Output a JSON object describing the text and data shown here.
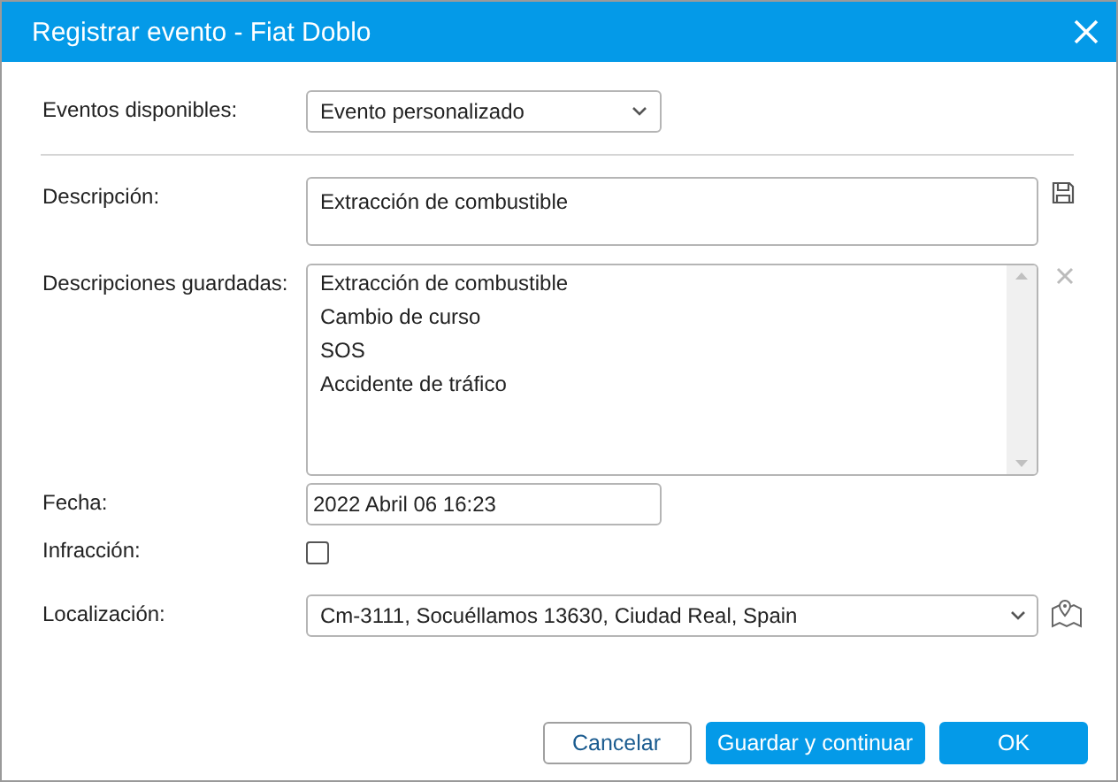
{
  "window": {
    "title": "Registrar evento - Fiat Doblo"
  },
  "available_events": {
    "label": "Eventos disponibles:",
    "value": "Evento personalizado"
  },
  "description": {
    "label": "Descripción:",
    "value": "Extracción de combustible"
  },
  "saved_descriptions": {
    "label": "Descripciones guardadas:",
    "items": [
      "Extracción de combustible",
      "Cambio de curso",
      "SOS",
      "Accidente de tráfico"
    ]
  },
  "date": {
    "label": "Fecha:",
    "value": "2022 Abril 06 16:23"
  },
  "violation": {
    "label": "Infracción:",
    "checked": false
  },
  "location": {
    "label": "Localización:",
    "value": "Cm-3111, Socuéllamos 13630, Ciudad Real, Spain"
  },
  "buttons": [
    {
      "label": "Cancelar",
      "kind": "secondary"
    },
    {
      "label": "Guardar y continuar",
      "kind": "primary"
    },
    {
      "label": "OK",
      "kind": "primary"
    }
  ]
}
